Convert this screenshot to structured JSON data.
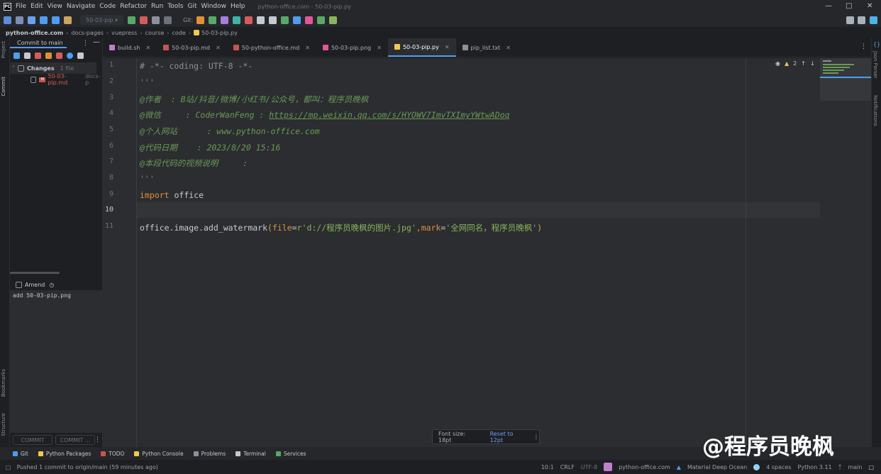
{
  "menubar": {
    "items": [
      "File",
      "Edit",
      "View",
      "Navigate",
      "Code",
      "Refactor",
      "Run",
      "Tools",
      "Git",
      "Window",
      "Help"
    ],
    "window_title": "python-office.com - 50-03-pip.py"
  },
  "toolbar": {
    "run_config": "50-03-pip",
    "git_label": "Git:"
  },
  "breadcrumb": [
    "python-office.com",
    "docs-pages",
    "vuepress",
    "course",
    "code",
    "50-03-pip.py"
  ],
  "left_strip": {
    "project": "Project",
    "commit": "Commit",
    "bookmarks": "Bookmarks",
    "structure": "Structure"
  },
  "commit_panel": {
    "title": "Commit to main",
    "changes_label": "Changes",
    "changes_count": "1 file",
    "file_name": "50-03-pip.md",
    "file_path": "docs-p",
    "amend_label": "Amend",
    "message": "add 50-03-pip.png",
    "commit_button": "COMMIT",
    "commit_push_button": "COMMIT ..."
  },
  "tabs": [
    {
      "label": "build.sh",
      "icon_color": "#c17fcb"
    },
    {
      "label": "50-03-pip.md",
      "icon_color": "#c75450"
    },
    {
      "label": "50-python-office.md",
      "icon_color": "#c75450"
    },
    {
      "label": "50-03-pip.png",
      "icon_color": "#e3569b"
    },
    {
      "label": "50-03-pip.py",
      "icon_color": "#f2c94c"
    },
    {
      "label": "pip_list.txt",
      "icon_color": "#8b929b"
    }
  ],
  "editor": {
    "line_numbers": [
      "1",
      "2",
      "3",
      "4",
      "5",
      "6",
      "7",
      "8",
      "9",
      "10",
      "11"
    ],
    "line1": "# -*- coding: UTF-8 -*-",
    "line2": "'''",
    "line3": "@作者  : B站/抖音/微博/小红书/公众号，都叫：程序员晚枫",
    "line4_a": "@微信     : CoderWanFeng : ",
    "line4_url": "https://mp.weixin.qq.com/s/HYOWV7ImvTXImyYWtwADoq",
    "line5": "@个人网站      : www.python-office.com",
    "line6": "@代码日期    : 2023/8/20 15:16",
    "line7": "@本段代码的视频说明     :",
    "line8": "'''",
    "line9_kw": "import",
    "line9_mod": " office",
    "line11_a": "office.image.add_watermark",
    "line11_p1": "(",
    "line11_k1": "file",
    "line11_eq1": "=",
    "line11_s1": "r'd://程序员晚枫的图片.jpg'",
    "line11_c": ",",
    "line11_k2": "mark",
    "line11_eq2": "=",
    "line11_s2": "'全网同名，程序员晚枫'",
    "line11_p2": ")",
    "inspections": "2"
  },
  "right_strip": {
    "json_parser": "Json Parser",
    "notifications": "Notifications"
  },
  "font_popup": {
    "label": "Font size: 18pt",
    "reset": "Reset to 12pt"
  },
  "bottom_tools": [
    "Git",
    "Python Packages",
    "TODO",
    "Python Console",
    "Problems",
    "Terminal",
    "Services"
  ],
  "status": {
    "message": "Pushed 1 commit to origin/main (59 minutes ago)",
    "position": "10:1",
    "line_sep": "CRLF",
    "encoding": "UTF-8",
    "project": "python-office.com",
    "theme": "Material Deep Ocean",
    "indent": "4 spaces",
    "interpreter": "Python 3.11",
    "branch": "main"
  },
  "watermark": "@程序员晚枫"
}
